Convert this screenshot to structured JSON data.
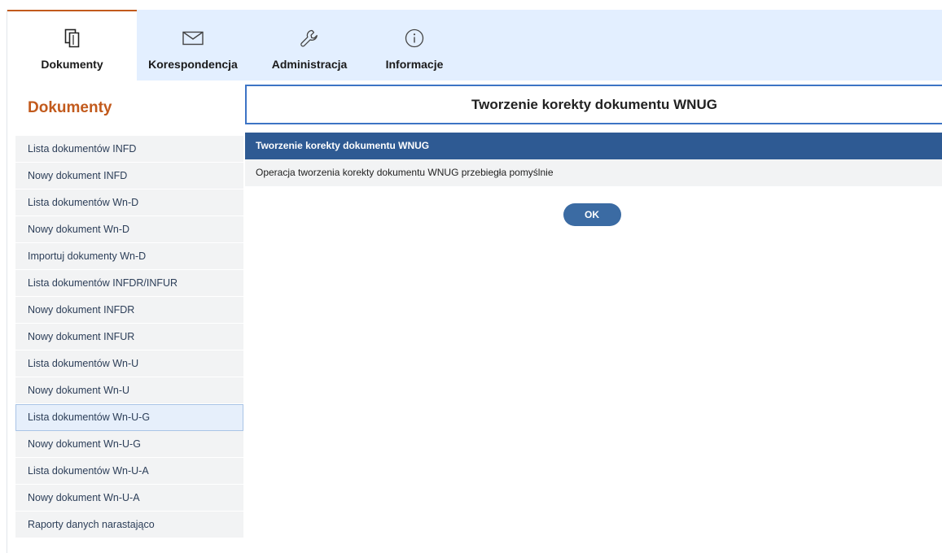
{
  "nav": {
    "tabs": [
      {
        "label": "Dokumenty",
        "icon": "documents-icon",
        "active": true
      },
      {
        "label": "Korespondencja",
        "icon": "envelope-icon",
        "active": false
      },
      {
        "label": "Administracja",
        "icon": "wrench-icon",
        "active": false
      },
      {
        "label": "Informacje",
        "icon": "info-icon",
        "active": false
      }
    ]
  },
  "sidebar": {
    "title": "Dokumenty",
    "items": [
      {
        "label": "Lista dokumentów INFD"
      },
      {
        "label": "Nowy dokument INFD"
      },
      {
        "label": "Lista dokumentów Wn-D"
      },
      {
        "label": "Nowy dokument Wn-D"
      },
      {
        "label": "Importuj dokumenty Wn-D"
      },
      {
        "label": "Lista dokumentów INFDR/INFUR"
      },
      {
        "label": "Nowy dokument INFDR"
      },
      {
        "label": "Nowy dokument INFUR"
      },
      {
        "label": "Lista dokumentów Wn-U"
      },
      {
        "label": "Nowy dokument Wn-U"
      },
      {
        "label": "Lista dokumentów Wn-U-G",
        "selected": true
      },
      {
        "label": "Nowy dokument Wn-U-G"
      },
      {
        "label": "Lista dokumentów Wn-U-A"
      },
      {
        "label": "Nowy dokument Wn-U-A"
      },
      {
        "label": "Raporty danych narastająco"
      }
    ]
  },
  "main": {
    "title": "Tworzenie korekty dokumentu WNUG",
    "panel": {
      "header": "Tworzenie korekty dokumentu WNUG",
      "message": "Operacja tworzenia korekty dokumentu WNUG przebiegła pomyślnie"
    },
    "ok_label": "OK"
  },
  "colors": {
    "accent": "#c25a1c",
    "nav_bg": "#e3efff",
    "panel_header": "#2e5a93",
    "button": "#3b6ba3",
    "header_border": "#3d74c5"
  }
}
